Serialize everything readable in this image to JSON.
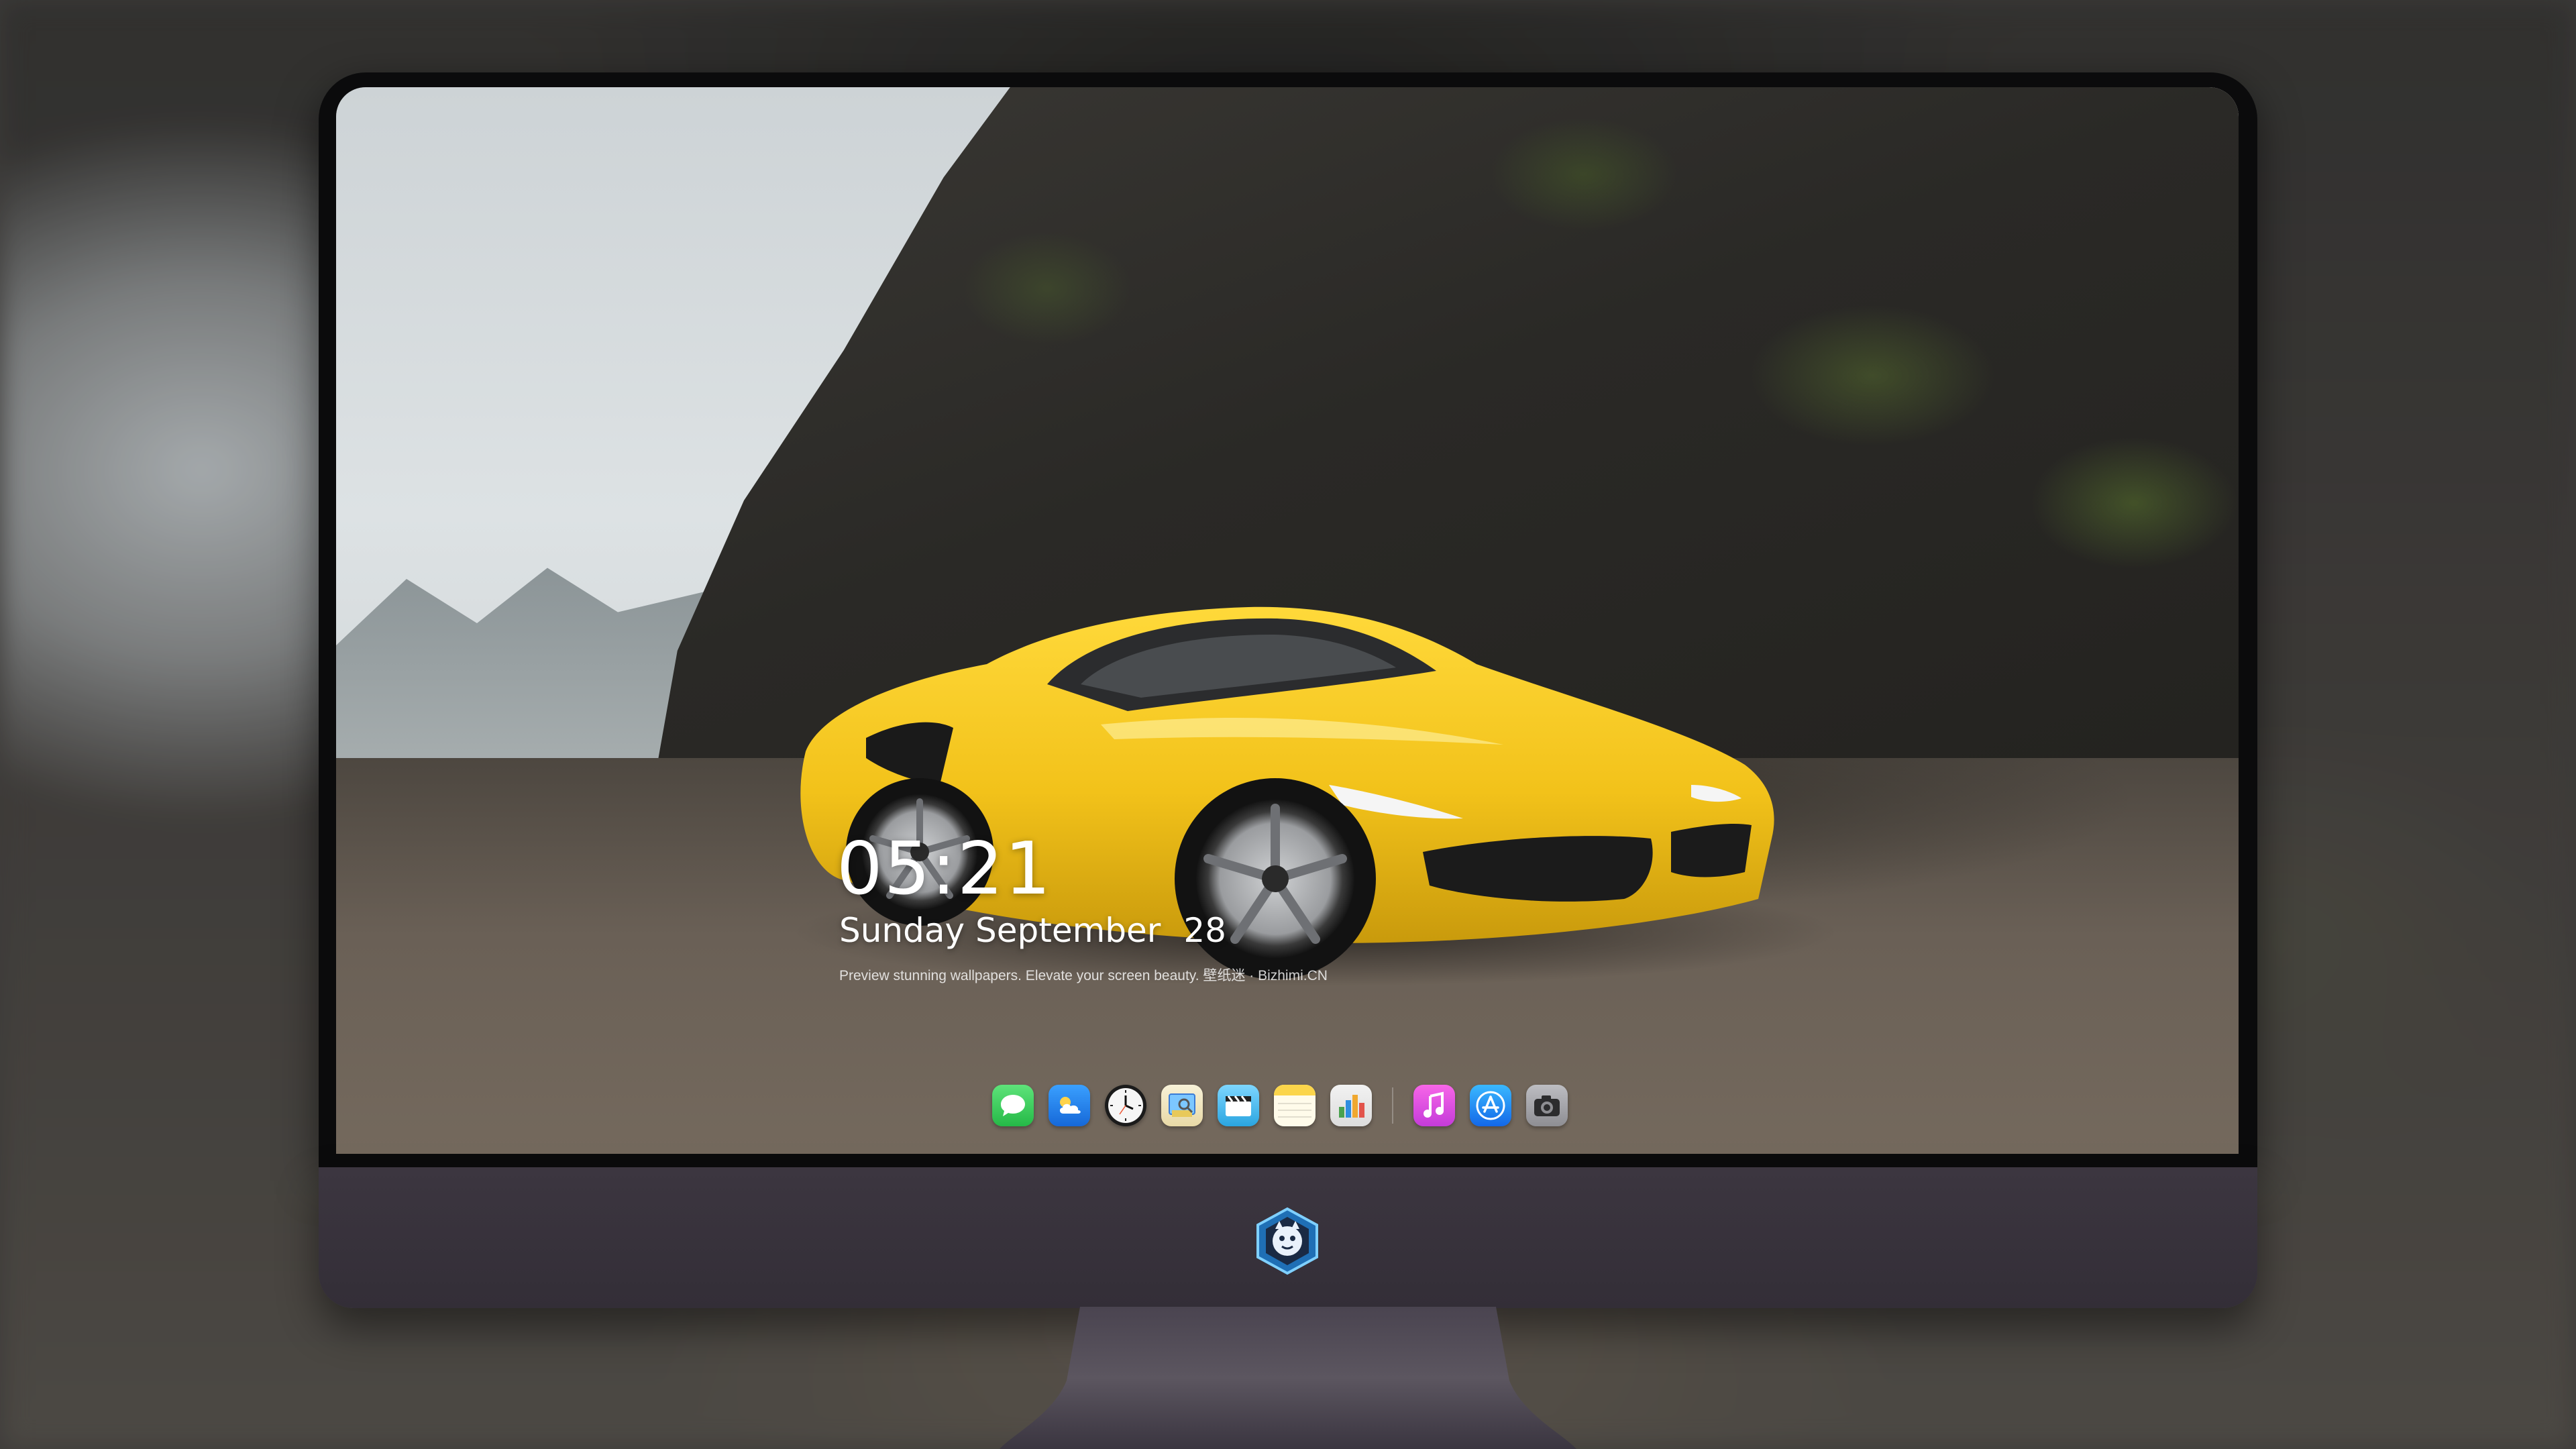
{
  "lock_screen": {
    "time": "05:21",
    "weekday_month": "Sunday September",
    "day": "28",
    "tagline": "Preview stunning wallpapers. Elevate your screen beauty. 壁纸迷 · Bizhimi.CN"
  },
  "dock": {
    "apps": [
      {
        "name": "messages-icon",
        "color": "#34c759"
      },
      {
        "name": "weather-icon",
        "color": "#1e90ff"
      },
      {
        "name": "clock-icon",
        "color": "#f2f2f2"
      },
      {
        "name": "preview-icon",
        "color": "#e8c95a"
      },
      {
        "name": "clips-icon",
        "color": "#3fb6e6"
      },
      {
        "name": "notes-icon",
        "color": "#fbd54b"
      },
      {
        "name": "numbers-icon",
        "color": "#4aa24f"
      },
      {
        "name": "itunes-icon",
        "color": "#e14bd6"
      },
      {
        "name": "app-store-icon",
        "color": "#1b7cf2"
      },
      {
        "name": "camera-icon",
        "color": "#8e8e93"
      }
    ]
  },
  "colors": {
    "car_body": "#f2c21a",
    "chin": "#3a343e"
  }
}
